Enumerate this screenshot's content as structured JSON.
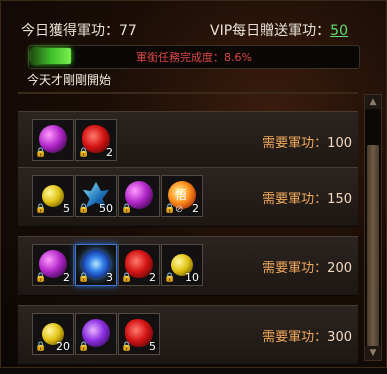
{
  "header": {
    "today_label": "今日獲得軍功：",
    "today_value": "77",
    "vip_label": "VIP每日贈送軍功：",
    "vip_value": "50"
  },
  "progress": {
    "text": "軍銜任務完成度：8.6%",
    "fraction": 0.086
  },
  "status_text": "今天才剛剛開始",
  "rewards": [
    {
      "requirement_label": "需要軍功：",
      "requirement_value": "100",
      "items": [
        {
          "icon": "purple-gem-icon",
          "count": ""
        },
        {
          "icon": "red-rose-icon",
          "count": "2"
        }
      ]
    },
    {
      "requirement_label": "需要軍功：",
      "requirement_value": "150",
      "items": [
        {
          "icon": "yellow-orb-icon",
          "count": "5"
        },
        {
          "icon": "blue-crystal-icon",
          "count": "50"
        },
        {
          "icon": "purple-gem-icon",
          "count": ""
        },
        {
          "icon": "enlightenment-orb-icon",
          "count": "2",
          "glyph": "悟"
        }
      ]
    },
    {
      "requirement_label": "需要軍功：",
      "requirement_value": "200",
      "items": [
        {
          "icon": "purple-gem-icon",
          "count": "2"
        },
        {
          "icon": "blue-vortex-icon",
          "count": "3"
        },
        {
          "icon": "red-rose-icon",
          "count": "2"
        },
        {
          "icon": "yellow-orb-icon",
          "count": "10"
        }
      ]
    },
    {
      "requirement_label": "需要軍功：",
      "requirement_value": "300",
      "items": [
        {
          "icon": "yellow-orb-icon",
          "count": "20"
        },
        {
          "icon": "violet-orb-icon",
          "count": ""
        },
        {
          "icon": "red-rose-icon",
          "count": "5"
        }
      ]
    }
  ]
}
